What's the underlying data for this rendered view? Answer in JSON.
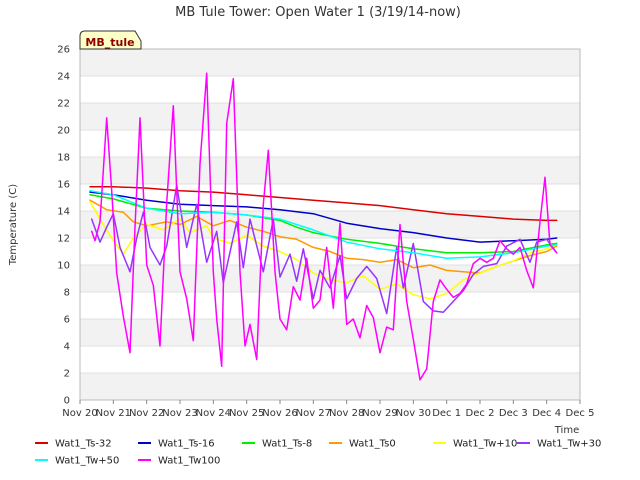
{
  "chart_data": {
    "type": "line",
    "title": "MB Tule Tower: Open Water 1 (3/19/14-now)",
    "badge": "MB_tule",
    "xlabel": "Time",
    "ylabel": "Temperature (C)",
    "xlim": [
      0,
      15
    ],
    "ylim": [
      0,
      26
    ],
    "grid": true,
    "legend_position": "bottom",
    "x_ticks": [
      {
        "x": 0,
        "label": "Nov 20"
      },
      {
        "x": 1,
        "label": "Nov 21"
      },
      {
        "x": 2,
        "label": "Nov 22"
      },
      {
        "x": 3,
        "label": "Nov 23"
      },
      {
        "x": 4,
        "label": "Nov 24"
      },
      {
        "x": 5,
        "label": "Nov 25"
      },
      {
        "x": 6,
        "label": "Nov 26"
      },
      {
        "x": 7,
        "label": "Nov 27"
      },
      {
        "x": 8,
        "label": "Nov 28"
      },
      {
        "x": 9,
        "label": "Nov 29"
      },
      {
        "x": 10,
        "label": "Nov 30"
      },
      {
        "x": 11,
        "label": "Dec 1"
      },
      {
        "x": 12,
        "label": "Dec 2"
      },
      {
        "x": 13,
        "label": "Dec 3"
      },
      {
        "x": 14,
        "label": "Dec 4"
      },
      {
        "x": 15,
        "label": "Dec 5"
      }
    ],
    "y_ticks": [
      0,
      2,
      4,
      6,
      8,
      10,
      12,
      14,
      16,
      18,
      20,
      22,
      24,
      26
    ],
    "series": [
      {
        "name": "Wat1_Ts-32",
        "color": "#dd0000",
        "x": [
          0.3,
          1,
          2,
          3,
          4,
          5,
          6,
          7,
          8,
          9,
          10,
          11,
          12,
          13,
          14,
          14.3
        ],
        "y": [
          15.8,
          15.8,
          15.7,
          15.5,
          15.4,
          15.2,
          15.0,
          14.8,
          14.6,
          14.4,
          14.1,
          13.8,
          13.6,
          13.4,
          13.3,
          13.3
        ]
      },
      {
        "name": "Wat1_Ts-16",
        "color": "#0000cc",
        "x": [
          0.3,
          1,
          2,
          3,
          4,
          5,
          6,
          7,
          8,
          9,
          10,
          11,
          12,
          13,
          14,
          14.3
        ],
        "y": [
          15.4,
          15.2,
          14.8,
          14.5,
          14.4,
          14.3,
          14.1,
          13.8,
          13.1,
          12.7,
          12.4,
          12.0,
          11.7,
          11.8,
          11.9,
          12.0
        ]
      },
      {
        "name": "Wat1_Ts-8",
        "color": "#00ee00",
        "x": [
          0.3,
          1,
          2,
          3,
          4,
          5,
          6,
          6.5,
          7,
          8,
          9,
          10,
          11,
          12,
          13,
          14,
          14.3
        ],
        "y": [
          15.2,
          14.9,
          14.2,
          14.0,
          13.9,
          13.7,
          13.3,
          12.8,
          12.4,
          11.9,
          11.6,
          11.2,
          10.9,
          10.9,
          11.0,
          11.5,
          11.6
        ]
      },
      {
        "name": "Wat1_Ts0",
        "color": "#ff9900",
        "x": [
          0.3,
          0.8,
          1.3,
          1.6,
          2,
          2.6,
          3,
          3.5,
          4,
          4.5,
          5,
          5.5,
          6,
          6.5,
          7,
          7.5,
          8,
          8.5,
          9,
          9.5,
          10,
          10.5,
          11,
          11.5,
          12,
          12.5,
          13,
          13.5,
          14,
          14.3
        ],
        "y": [
          14.8,
          14.1,
          13.9,
          13.2,
          12.9,
          13.2,
          13.0,
          13.6,
          12.9,
          13.3,
          12.8,
          12.5,
          12.1,
          11.9,
          11.3,
          11.0,
          10.5,
          10.4,
          10.2,
          10.4,
          9.8,
          10.0,
          9.6,
          9.5,
          9.4,
          9.9,
          10.3,
          10.7,
          11.0,
          11.4
        ]
      },
      {
        "name": "Wat1_Tw+10",
        "color": "#ffff00",
        "x": [
          0.3,
          0.7,
          1.0,
          1.3,
          1.6,
          2,
          2.5,
          3,
          3.3,
          3.8,
          4,
          4.5,
          5,
          5.5,
          6,
          6.5,
          7,
          7.5,
          8,
          8.5,
          9,
          9.5,
          10,
          10.5,
          11,
          11.5,
          12,
          12.5,
          13,
          13.5,
          14,
          14.3
        ],
        "y": [
          14.7,
          13.0,
          11.8,
          10.8,
          12.0,
          13.0,
          12.6,
          13.4,
          12.4,
          12.9,
          12.0,
          11.6,
          12.2,
          11.4,
          11.0,
          10.4,
          9.4,
          8.9,
          8.7,
          9.2,
          8.2,
          8.6,
          7.8,
          7.5,
          7.9,
          8.9,
          9.4,
          9.9,
          10.3,
          10.9,
          11.2,
          11.5
        ]
      },
      {
        "name": "Wat1_Tw+30",
        "color": "#9933ff",
        "x": [
          0.35,
          0.6,
          0.8,
          1.0,
          1.2,
          1.5,
          1.7,
          1.9,
          2.1,
          2.4,
          2.6,
          2.9,
          3.2,
          3.5,
          3.8,
          4.1,
          4.3,
          4.7,
          4.9,
          5.1,
          5.5,
          5.8,
          6.0,
          6.3,
          6.5,
          6.7,
          7.0,
          7.2,
          7.5,
          7.8,
          8.0,
          8.3,
          8.6,
          8.9,
          9.2,
          9.5,
          9.7,
          10.0,
          10.3,
          10.6,
          10.9,
          11.2,
          11.5,
          11.8,
          12.1,
          12.5,
          12.8,
          13.2,
          13.5,
          13.7,
          14.0,
          14.3
        ],
        "y": [
          13.4,
          11.7,
          12.8,
          13.8,
          11.3,
          9.5,
          12.0,
          13.9,
          11.3,
          10.0,
          11.4,
          15.9,
          11.3,
          14.5,
          10.2,
          12.5,
          8.7,
          13.2,
          9.8,
          13.4,
          9.5,
          13.4,
          9.1,
          10.8,
          8.8,
          11.2,
          7.5,
          9.6,
          8.3,
          10.7,
          7.5,
          9.0,
          9.9,
          9.0,
          6.4,
          11.3,
          8.3,
          11.6,
          7.3,
          6.6,
          6.5,
          7.3,
          8.1,
          9.3,
          9.9,
          10.1,
          11.4,
          11.9,
          10.2,
          11.7,
          11.9,
          10.9
        ]
      },
      {
        "name": "Wat1_Tw+50",
        "color": "#00ffff",
        "x": [
          0.3,
          1,
          2,
          3,
          4,
          5,
          6,
          7,
          8,
          9,
          10,
          11,
          12,
          13,
          14,
          14.3
        ],
        "y": [
          15.5,
          15.2,
          14.2,
          13.8,
          13.9,
          13.7,
          13.4,
          12.6,
          11.7,
          11.2,
          10.9,
          10.5,
          10.6,
          10.9,
          11.4,
          11.5
        ]
      },
      {
        "name": "Wat1_Tw100",
        "color": "#ff00ff",
        "x": [
          0.35,
          0.45,
          0.6,
          0.8,
          0.95,
          1.1,
          1.3,
          1.5,
          1.65,
          1.8,
          2.0,
          2.2,
          2.4,
          2.6,
          2.8,
          3.0,
          3.2,
          3.4,
          3.6,
          3.8,
          4.0,
          4.1,
          4.25,
          4.4,
          4.6,
          4.8,
          4.95,
          5.1,
          5.3,
          5.5,
          5.65,
          5.85,
          6.0,
          6.2,
          6.4,
          6.6,
          6.8,
          7.0,
          7.2,
          7.4,
          7.6,
          7.8,
          8.0,
          8.2,
          8.4,
          8.6,
          8.8,
          9.0,
          9.2,
          9.4,
          9.6,
          9.8,
          10.0,
          10.2,
          10.4,
          10.6,
          10.8,
          11.0,
          11.2,
          11.4,
          11.6,
          11.8,
          12.0,
          12.2,
          12.4,
          12.6,
          12.8,
          13.0,
          13.2,
          13.4,
          13.6,
          13.8,
          13.95,
          14.1,
          14.3
        ],
        "y": [
          12.5,
          11.8,
          13.2,
          20.9,
          15.5,
          9.4,
          6.2,
          3.5,
          12.8,
          20.9,
          10.0,
          8.5,
          4.0,
          14.6,
          21.8,
          9.5,
          7.5,
          4.4,
          17.5,
          24.2,
          9.5,
          6.0,
          2.5,
          20.5,
          23.8,
          9.5,
          4.0,
          5.6,
          3.0,
          14.5,
          18.5,
          9.5,
          6.0,
          5.2,
          8.4,
          7.4,
          10.5,
          6.8,
          7.4,
          11.3,
          6.8,
          13.1,
          5.6,
          6.0,
          4.6,
          7.0,
          6.1,
          3.5,
          5.4,
          5.2,
          13.0,
          7.3,
          4.5,
          1.5,
          2.3,
          7.3,
          8.9,
          8.2,
          7.6,
          7.9,
          8.6,
          10.1,
          10.5,
          10.2,
          10.5,
          11.8,
          11.2,
          10.8,
          11.3,
          9.6,
          8.3,
          13.2,
          16.5,
          11.5,
          10.9
        ]
      }
    ]
  }
}
